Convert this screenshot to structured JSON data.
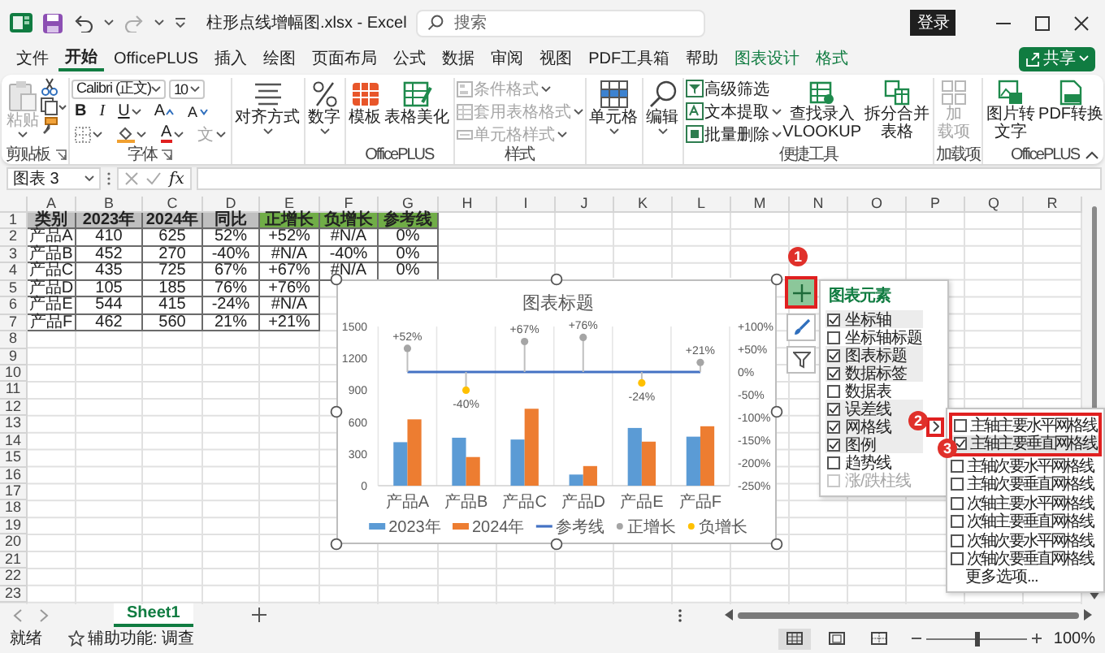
{
  "title_bar": {
    "document_title": "柱形点线增幅图.xlsx  -  Excel",
    "search": {
      "placeholder": "搜索"
    },
    "sign_in": "登录"
  },
  "menu_tabs": [
    {
      "label": "文件",
      "selected": false,
      "contextual": false
    },
    {
      "label": "开始",
      "selected": true,
      "contextual": false
    },
    {
      "label": "OfficePLUS",
      "selected": false,
      "contextual": false
    },
    {
      "label": "插入",
      "selected": false,
      "contextual": false
    },
    {
      "label": "绘图",
      "selected": false,
      "contextual": false
    },
    {
      "label": "页面布局",
      "selected": false,
      "contextual": false
    },
    {
      "label": "公式",
      "selected": false,
      "contextual": false
    },
    {
      "label": "数据",
      "selected": false,
      "contextual": false
    },
    {
      "label": "审阅",
      "selected": false,
      "contextual": false
    },
    {
      "label": "视图",
      "selected": false,
      "contextual": false
    },
    {
      "label": "PDF工具箱",
      "selected": false,
      "contextual": false
    },
    {
      "label": "帮助",
      "selected": false,
      "contextual": false
    },
    {
      "label": "图表设计",
      "selected": false,
      "contextual": true
    },
    {
      "label": "格式",
      "selected": false,
      "contextual": true
    }
  ],
  "share_button": "共享",
  "ribbon": {
    "clipboard": {
      "paste": {
        "label": "粘贴",
        "disabled": true
      },
      "label": "剪贴板"
    },
    "font": {
      "family": "Calibri (正文)",
      "size": "10",
      "bold": "B",
      "italic": "I",
      "underline": "U",
      "grow": "A",
      "shrink": "A",
      "color_button": "A",
      "phonetic": {
        "label": "文",
        "disabled": true
      },
      "label": "字体"
    },
    "alignment": {
      "label": "对齐方式"
    },
    "number": {
      "label": "数字"
    },
    "officeplus": {
      "items": [
        {
          "label": "模板"
        },
        {
          "label": "表格美化"
        }
      ],
      "label": "OfficePLUS"
    },
    "styles": {
      "items": [
        {
          "label": "条件格式",
          "disabled": true
        },
        {
          "label": "套用表格格式",
          "disabled": true
        },
        {
          "label": "单元格样式",
          "disabled": true
        }
      ],
      "label": "样式"
    },
    "cells": {
      "label": "单元格"
    },
    "editing": {
      "label": "编辑"
    },
    "tools": {
      "items": [
        {
          "label": "高级筛选"
        },
        {
          "label": "文本提取"
        },
        {
          "label": "批量删除"
        }
      ],
      "lookup": [
        "查找录入",
        "VLOOKUP"
      ],
      "split": [
        "拆分合并",
        "表格"
      ],
      "label": "便捷工具"
    },
    "addins": {
      "button": {
        "lines": [
          "加",
          "载项"
        ],
        "disabled": true
      },
      "label": "加载项"
    },
    "officeplus2": {
      "pic": [
        "图片转",
        "文字"
      ],
      "pdf": [
        "PDF转换"
      ],
      "label": "OfficePLUS"
    }
  },
  "formula_bar": {
    "name_box": "图表 3",
    "fx": "fx"
  },
  "sheet": {
    "column_letters": [
      "A",
      "B",
      "C",
      "D",
      "E",
      "F",
      "G",
      "H",
      "I",
      "J",
      "K",
      "L",
      "M",
      "N",
      "O",
      "P",
      "Q",
      "R"
    ],
    "row_numbers": [
      "1",
      "2",
      "3",
      "4",
      "5",
      "6",
      "7",
      "8",
      "9",
      "10",
      "11",
      "12",
      "13",
      "14",
      "15",
      "16",
      "17",
      "18",
      "19",
      "20",
      "21",
      "22",
      "23"
    ],
    "table": {
      "header": [
        {
          "text": "类别",
          "color": "#bfbfbf"
        },
        {
          "text": "2023年",
          "color": "#bfbfbf"
        },
        {
          "text": "2024年",
          "color": "#bfbfbf"
        },
        {
          "text": "同比",
          "color": "#bfbfbf"
        },
        {
          "text": "正增长",
          "color": "#70ad47"
        },
        {
          "text": "负增长",
          "color": "#70ad47"
        },
        {
          "text": "参考线",
          "color": "#70ad47"
        }
      ],
      "rows": [
        [
          "产品A",
          "410",
          "625",
          "52%",
          "+52%",
          "#N/A",
          "0%"
        ],
        [
          "产品B",
          "452",
          "270",
          "-40%",
          "#N/A",
          "-40%",
          "0%"
        ],
        [
          "产品C",
          "435",
          "725",
          "67%",
          "+67%",
          "#N/A",
          "0%"
        ],
        [
          "产品D",
          "105",
          "185",
          "76%",
          "+76%"
        ],
        [
          "产品E",
          "544",
          "415",
          "-24%",
          "#N/A"
        ],
        [
          "产品F",
          "462",
          "560",
          "21%",
          "+21%"
        ]
      ]
    }
  },
  "chart": {
    "selected": true,
    "chart_data": {
      "type": "bar",
      "title": "图表标题",
      "categories": [
        "产品A",
        "产品B",
        "产品C",
        "产品D",
        "产品E",
        "产品F"
      ],
      "series": [
        {
          "name": "2023年",
          "color": "#5b9bd5",
          "type": "bar",
          "values": [
            410,
            452,
            435,
            105,
            544,
            462
          ]
        },
        {
          "name": "2024年",
          "color": "#ed7d31",
          "type": "bar",
          "values": [
            625,
            270,
            725,
            185,
            415,
            560
          ]
        },
        {
          "name": "参考线",
          "color": "#4472c4",
          "type": "line",
          "axis": "y2",
          "values": [
            0,
            0,
            0,
            0,
            0,
            0
          ]
        },
        {
          "name": "正增长",
          "color": "#a5a5a5",
          "type": "scatter",
          "axis": "y2",
          "values": [
            52,
            null,
            67,
            76,
            null,
            21
          ],
          "value_labels": [
            "+52%",
            null,
            "+67%",
            "+76%",
            null,
            "+21%"
          ]
        },
        {
          "name": "负增长",
          "color": "#ffc000",
          "type": "scatter",
          "axis": "y2",
          "values": [
            null,
            -40,
            null,
            null,
            -24,
            null
          ],
          "value_labels": [
            null,
            "-40%",
            null,
            null,
            "-24%",
            null
          ]
        }
      ],
      "stacked": false,
      "legend": "bottom",
      "ylim": [
        0,
        1500
      ],
      "yticks": [
        0,
        300,
        600,
        900,
        1200,
        1500
      ],
      "y2lim": [
        -250,
        100
      ],
      "y2ticks": [
        {
          "value": 100,
          "label": "+100%"
        },
        {
          "value": 50,
          "label": "+50%"
        },
        {
          "value": 0,
          "label": "0%"
        },
        {
          "value": -50,
          "label": "-50%"
        },
        {
          "value": -100,
          "label": "-100%"
        },
        {
          "value": -150,
          "label": "-150%"
        },
        {
          "value": -200,
          "label": "-200%"
        },
        {
          "value": -250,
          "label": "-250%"
        }
      ]
    }
  },
  "chart_buttons": [
    {
      "selected": true,
      "annotated": true
    },
    {
      "selected": false,
      "annotated": false
    },
    {
      "selected": false,
      "annotated": false
    }
  ],
  "chart_elements": {
    "title": "图表元素",
    "items": [
      {
        "label": "坐标轴",
        "checked": true,
        "disabled": false,
        "submenu": false,
        "annotated": false
      },
      {
        "label": "坐标轴标题",
        "checked": false,
        "disabled": false,
        "submenu": false,
        "annotated": false
      },
      {
        "label": "图表标题",
        "checked": true,
        "disabled": false,
        "submenu": false,
        "annotated": false
      },
      {
        "label": "数据标签",
        "checked": true,
        "disabled": false,
        "submenu": false,
        "annotated": false
      },
      {
        "label": "数据表",
        "checked": false,
        "disabled": false,
        "submenu": false,
        "annotated": false
      },
      {
        "label": "误差线",
        "checked": true,
        "disabled": false,
        "submenu": false,
        "annotated": false
      },
      {
        "label": "网格线",
        "checked": true,
        "disabled": false,
        "submenu": true,
        "annotated": true
      },
      {
        "label": "图例",
        "checked": true,
        "disabled": false,
        "submenu": false,
        "annotated": false
      },
      {
        "label": "趋势线",
        "checked": false,
        "disabled": false,
        "submenu": false,
        "annotated": false
      },
      {
        "label": "涨/跌柱线",
        "checked": false,
        "disabled": true,
        "submenu": false,
        "annotated": false
      }
    ]
  },
  "gridlines_menu": {
    "items": [
      {
        "label": "主轴主要水平网格线",
        "checked": false,
        "selected": false,
        "annotated": true
      },
      {
        "label": "主轴主要垂直网格线",
        "checked": true,
        "selected": true,
        "annotated": true
      },
      {
        "label": "主轴次要水平网格线",
        "checked": false,
        "selected": false,
        "annotated": false
      },
      {
        "label": "主轴次要垂直网格线",
        "checked": false,
        "selected": false,
        "annotated": false
      },
      {
        "label": "次轴主要水平网格线",
        "checked": false,
        "selected": false,
        "annotated": false
      },
      {
        "label": "次轴主要垂直网格线",
        "checked": false,
        "selected": false,
        "annotated": false
      },
      {
        "label": "次轴次要水平网格线",
        "checked": false,
        "selected": false,
        "annotated": false
      },
      {
        "label": "次轴次要垂直网格线",
        "checked": false,
        "selected": false,
        "annotated": false
      }
    ],
    "more": "更多选项..."
  },
  "callouts": [
    "1",
    "2",
    "3"
  ],
  "sheet_tabs": [
    {
      "label": "Sheet1",
      "selected": true
    }
  ],
  "status_bar": {
    "ready": "就绪",
    "accessibility": "辅助功能: 调查",
    "views": [
      {
        "selected": true
      },
      {
        "selected": false
      },
      {
        "selected": false
      }
    ],
    "zoom": {
      "level": 0.5,
      "reading": "100%"
    }
  }
}
